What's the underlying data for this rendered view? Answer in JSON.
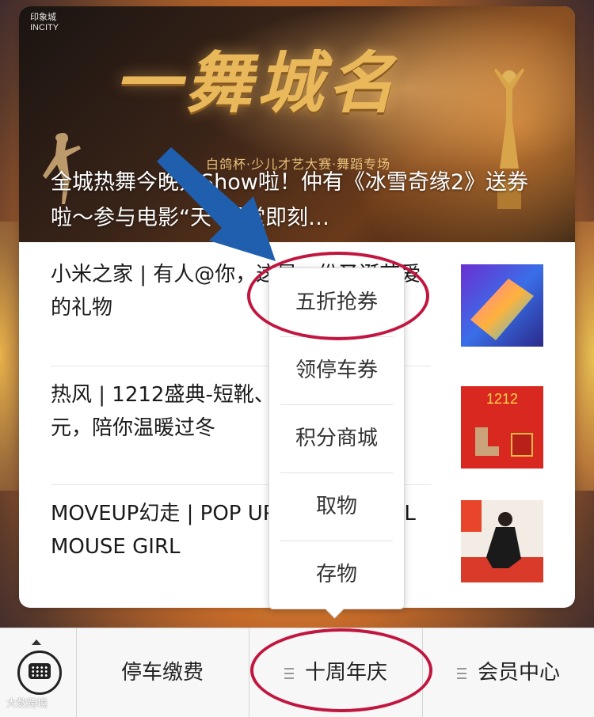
{
  "banner": {
    "logo": "印象城\nINCITY",
    "title": "一舞城名",
    "subtitle": "白鸽杯·少儿才艺大赛·舞蹈专场",
    "headline": "全城热舞今晚开Show啦！仲有《冰雪奇缘2》送券啦～参与电影“天”课堂即刻…"
  },
  "articles": [
    {
      "text": "小米之家 | 有人@你，这是一份圣诞节爱的礼物",
      "thumb_icon": "phone-image"
    },
    {
      "text": "热风 | 1212盛典-短靴、雪地靴直降80元，陪你温暖过冬",
      "thumb_icon": "boots-image"
    },
    {
      "text": "MOVEUP幻走 | POP UP STORE COOL MOUSE GIRL",
      "thumb_icon": "model-image"
    }
  ],
  "popup_menu": {
    "items": [
      "五折抢券",
      "领停车券",
      "积分商城",
      "取物",
      "存物"
    ]
  },
  "tabbar": {
    "items": [
      "停车缴费",
      "十周年庆",
      "会员中心"
    ]
  },
  "watermark": "大数跨境",
  "colors": {
    "annotation_red": "#c0163f",
    "arrow_blue": "#1f5fae"
  }
}
